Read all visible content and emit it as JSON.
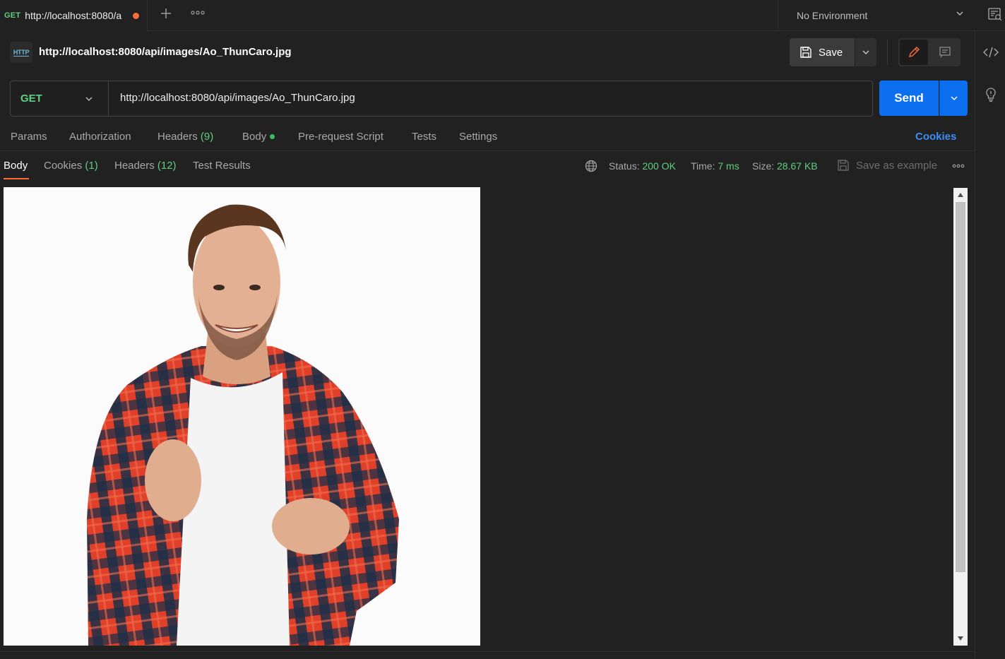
{
  "tab": {
    "method": "GET",
    "title": "http://localhost:8080/a"
  },
  "environment": {
    "label": "No Environment"
  },
  "request": {
    "name": "http://localhost:8080/api/images/Ao_ThunCaro.jpg",
    "badge": "HTTP",
    "save_label": "Save",
    "method": "GET",
    "url": "http://localhost:8080/api/images/Ao_ThunCaro.jpg",
    "send_label": "Send"
  },
  "request_tabs": {
    "params": "Params",
    "authorization": "Authorization",
    "headers": "Headers",
    "headers_count": "(9)",
    "body": "Body",
    "pre_request": "Pre-request Script",
    "tests": "Tests",
    "settings": "Settings",
    "cookies": "Cookies"
  },
  "response_tabs": {
    "body": "Body",
    "cookies": "Cookies",
    "cookies_count": "(1)",
    "headers": "Headers",
    "headers_count": "(12)",
    "test_results": "Test Results"
  },
  "response_meta": {
    "status_label": "Status:",
    "status_value": "200 OK",
    "time_label": "Time:",
    "time_value": "7 ms",
    "size_label": "Size:",
    "size_value": "28.67 KB",
    "save_example": "Save as example"
  },
  "colors": {
    "accent_orange": "#ff6c37",
    "send_blue": "#0b6ff0",
    "success_green": "#5fcf80",
    "link_blue": "#3d8cf2"
  },
  "icons": [
    "plus-icon",
    "more-icon",
    "chevron-down-icon",
    "environment-quicklook-icon",
    "code-icon",
    "lightbulb-icon",
    "save-icon",
    "pencil-icon",
    "comment-icon",
    "globe-icon"
  ]
}
